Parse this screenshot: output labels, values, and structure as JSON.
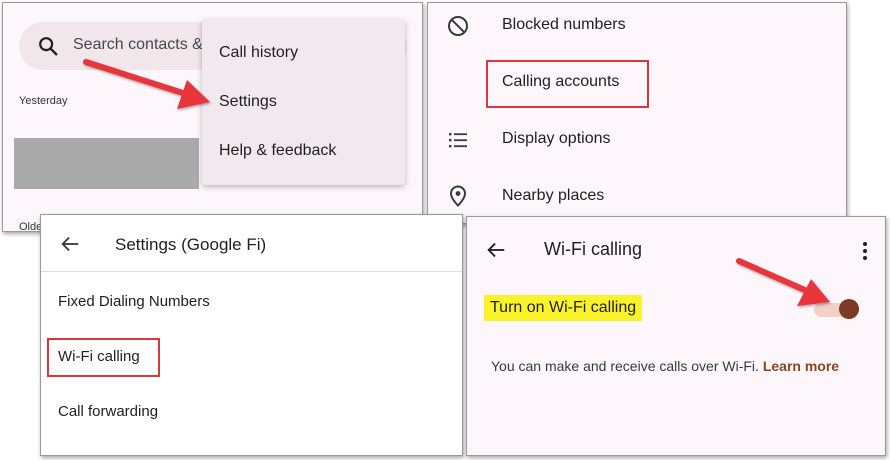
{
  "recents_panel": {
    "search_placeholder": "Search contacts &",
    "section_yesterday": "Yesterday",
    "section_older": "Olde",
    "overflow_menu": {
      "items": [
        "Call history",
        "Settings",
        "Help & feedback"
      ]
    }
  },
  "settings_list_panel": {
    "items": [
      {
        "label": "Blocked numbers",
        "icon": "block-icon"
      },
      {
        "label": "Calling accounts",
        "icon": ""
      },
      {
        "label": "Display options",
        "icon": "list-icon"
      },
      {
        "label": "Nearby places",
        "icon": "location-pin-icon"
      }
    ]
  },
  "google_fi_panel": {
    "title": "Settings (Google Fi)",
    "items": [
      "Fixed Dialing Numbers",
      "Wi-Fi calling",
      "Call forwarding"
    ]
  },
  "wifi_calling_panel": {
    "title": "Wi-Fi calling",
    "toggle_label": "Turn on Wi-Fi calling",
    "toggle_state": "on",
    "description": "You can make and receive calls over Wi-Fi.",
    "learn_more": "Learn more"
  },
  "colors": {
    "annotation_red": "#d9383a",
    "highlight_yellow": "#fbf32a",
    "toggle_thumb": "#7d3b25",
    "toggle_track": "#f3d0c6",
    "link": "#8a4425"
  }
}
